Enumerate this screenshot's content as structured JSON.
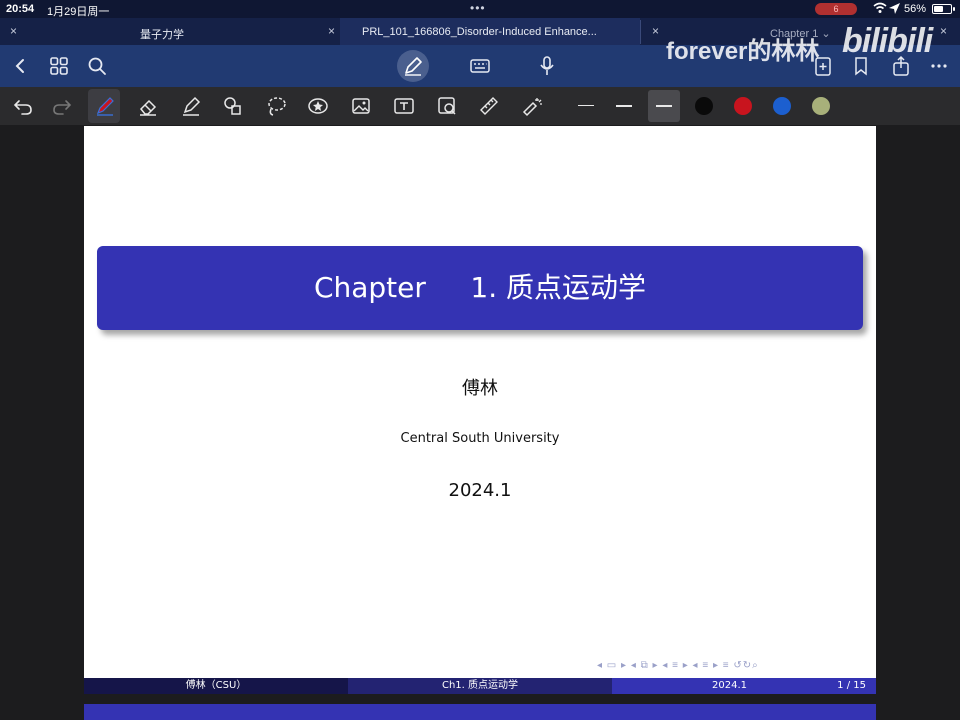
{
  "status_bar": {
    "time": "20:54",
    "date": "1月29日周一",
    "dots": "•••",
    "battery_percent": "56%",
    "battery_level": 0.56,
    "record_badge": "6"
  },
  "tabs": [
    {
      "label": "量子力学",
      "active": false
    },
    {
      "label": "PRL_101_166806_Disorder-Induced Enhance...",
      "active": true
    }
  ],
  "navbar": {
    "chapter_selector": "Chapter 1 ⌄",
    "watermark": "forever的林林",
    "bili_logo": "bilibili"
  },
  "toolbar": {
    "icons": [
      "undo-icon",
      "redo-icon",
      "pen-icon",
      "eraser-icon",
      "highlighter-icon",
      "shapes-icon",
      "lasso-icon",
      "sticker-icon",
      "image-icon",
      "text-icon",
      "camera-icon",
      "ruler-icon",
      "laser-icon"
    ],
    "colors": [
      "#0a0a0a",
      "#c8141e",
      "#1c5fcf",
      "#a8b07a"
    ]
  },
  "slide": {
    "title": "Chapter     1. 质点运动学",
    "author": "傅林",
    "institute": "Central South University",
    "date": "2024.1",
    "nav_symbols": "◂ ▭ ▸ ◂ ⧉ ▸ ◂ ≡ ▸ ◂ ≡ ▸   ≡   ↺↻⌕"
  },
  "footer": {
    "author": "傅林（CSU）",
    "title": "Ch1. 质点运动学",
    "date": "2024.1",
    "page": "1 / 15"
  }
}
